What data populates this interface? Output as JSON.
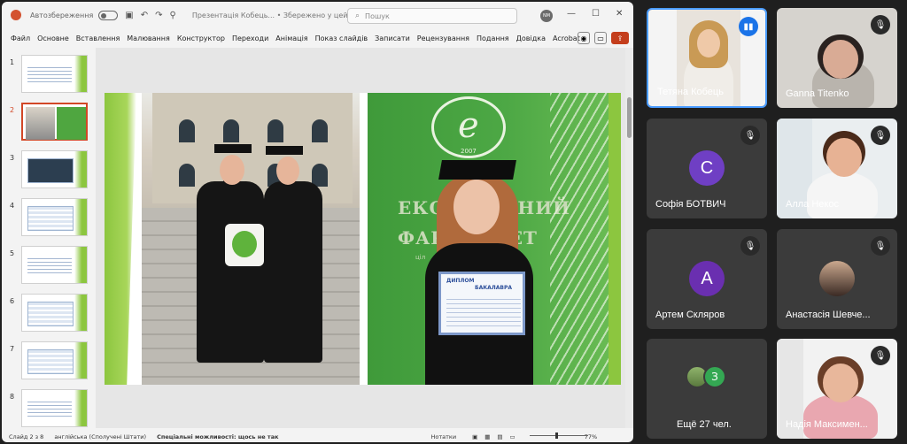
{
  "powerpoint": {
    "autosave_label": "Автозбереження",
    "document_title": "Презентація Кобець... • Збережено у цей ПК",
    "search_placeholder": "Пошук",
    "user_initials": "NM",
    "ribbon_tabs": [
      "Файл",
      "Основне",
      "Вставлення",
      "Малювання",
      "Конструктор",
      "Переходи",
      "Анімація",
      "Показ слайдів",
      "Записати",
      "Рецензування",
      "Подання",
      "Довідка",
      "Acrobat"
    ],
    "slide_numbers": [
      "1",
      "2",
      "3",
      "4",
      "5",
      "6",
      "7",
      "8"
    ],
    "active_slide": 2,
    "slide_text": {
      "emblem_letter": "e",
      "emblem_year": "2007",
      "wall_line1": "ЕКОЛОГІЧНИЙ",
      "wall_line2": "ФАКУЛЬТЕТ",
      "wall_line3": "ціл",
      "diploma_title": "ДИПЛОМ",
      "diploma_subtitle": "БАКАЛАВРА"
    },
    "status": {
      "slide_counter": "Слайд 2 з 8",
      "language": "англійська (Сполучені Штати)",
      "accessibility": "Спеціальні можливості: щось не так",
      "notes": "Нотатки",
      "zoom": "77%"
    }
  },
  "meeting": {
    "participants": [
      {
        "name": "Тетяна Кобець",
        "mic": "on",
        "type": "video",
        "speaking": true
      },
      {
        "name": "Ganna Titenko",
        "mic": "off",
        "type": "video"
      },
      {
        "name": "Софія БОТВИЧ",
        "mic": "off",
        "type": "initial",
        "initial": "С",
        "color": "#6f3fc4"
      },
      {
        "name": "Алла Некос",
        "mic": "off",
        "type": "video"
      },
      {
        "name": "Артем Скляров",
        "mic": "off",
        "type": "initial",
        "initial": "А",
        "color": "#6a2fb0"
      },
      {
        "name": "Анастасія Шевче...",
        "mic": "off",
        "type": "photo"
      },
      {
        "name": "Ещё 27 чел.",
        "type": "more",
        "initial": "З",
        "color": "#34a853"
      },
      {
        "name": "Надія Максимен...",
        "mic": "off",
        "type": "video"
      }
    ]
  },
  "icons": {
    "mic_off": "mic-off-icon",
    "mic_on": "mic-on-icon",
    "search": "search-icon"
  },
  "colors": {
    "accent_green": "#8cc63f",
    "ppt_red": "#d24726",
    "meet_speaking": "#4a9cff"
  }
}
